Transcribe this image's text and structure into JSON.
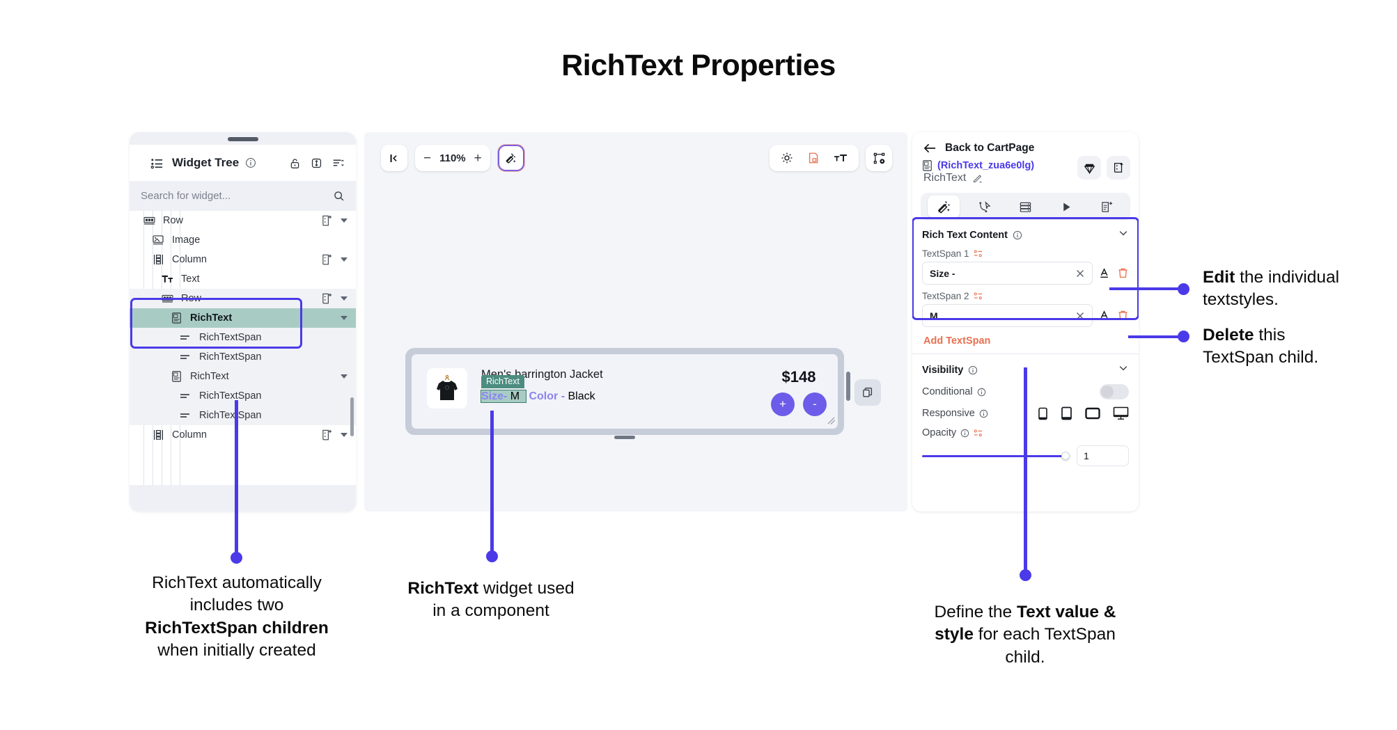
{
  "page": {
    "title": "RichText Properties"
  },
  "tree": {
    "panel_title": "Widget Tree",
    "search_placeholder": "Search for widget...",
    "icons": {
      "list": "widget-tree-icon",
      "info": "info-icon",
      "lock": "lock-icon",
      "expand": "expand-collapse-icon",
      "sort": "sort-icon",
      "search": "search-icon"
    },
    "items": [
      {
        "label": "Row",
        "type": "row",
        "depth": 1,
        "add": true,
        "caret": true,
        "alt": false,
        "selected": false
      },
      {
        "label": "Image",
        "type": "image",
        "depth": 2,
        "add": false,
        "caret": false,
        "alt": false,
        "selected": false
      },
      {
        "label": "Column",
        "type": "column",
        "depth": 2,
        "add": true,
        "caret": true,
        "alt": false,
        "selected": false
      },
      {
        "label": "Text",
        "type": "text",
        "depth": 3,
        "add": false,
        "caret": false,
        "alt": false,
        "selected": false
      },
      {
        "label": "Row",
        "type": "row",
        "depth": 3,
        "add": true,
        "caret": true,
        "alt": true,
        "selected": false
      },
      {
        "label": "RichText",
        "type": "richtext",
        "depth": 4,
        "add": false,
        "caret": true,
        "alt": false,
        "selected": true
      },
      {
        "label": "RichTextSpan",
        "type": "span",
        "depth": 5,
        "add": false,
        "caret": false,
        "alt": true,
        "selected": false
      },
      {
        "label": "RichTextSpan",
        "type": "span",
        "depth": 5,
        "add": false,
        "caret": false,
        "alt": true,
        "selected": false
      },
      {
        "label": "RichText",
        "type": "richtext",
        "depth": 4,
        "add": false,
        "caret": true,
        "alt": true,
        "selected": false
      },
      {
        "label": "RichTextSpan",
        "type": "span",
        "depth": 5,
        "add": false,
        "caret": false,
        "alt": true,
        "selected": false
      },
      {
        "label": "RichTextSpan",
        "type": "span",
        "depth": 5,
        "add": false,
        "caret": false,
        "alt": true,
        "selected": false
      },
      {
        "label": "Column",
        "type": "column",
        "depth": 2,
        "add": true,
        "caret": true,
        "alt": false,
        "selected": false
      }
    ]
  },
  "canvas": {
    "collapse_label": "collapse-left-panel-icon",
    "zoom_out": "−",
    "zoom_value": "110%",
    "zoom_in": "+",
    "magic_icon": "ai-gen-icon",
    "theme_icon": "theme-brightness-icon",
    "layout_icon": "page-layout-icon",
    "typography_icon": "typography-icon",
    "settings_icon": "canvas-settings-icon",
    "duplicate_icon": "duplicate-icon",
    "product": {
      "name": "Men's barrington Jacket",
      "size_key": "Size",
      "size_dash": "-",
      "size_value": "M",
      "color_key": "Color",
      "color_dash": "-",
      "color_value": "Black",
      "price": "$148",
      "plus": "+",
      "minus": "-",
      "badge": "RichText"
    }
  },
  "props": {
    "back_label": "Back to CartPage",
    "widget_id": "(RichText_zua6e0lg)",
    "widget_type": "RichText",
    "edit_icon": "pencil-icon",
    "action_icons": [
      "diamond-theme-icon",
      "add-component-icon"
    ],
    "tabs": [
      "properties-tab",
      "actions-tab",
      "backend-query-tab",
      "test-mode-tab",
      "add-element-tab"
    ],
    "rich_text": {
      "section_title": "Rich Text Content",
      "spans": [
        {
          "label": "TextSpan 1",
          "value": "Size -"
        },
        {
          "label": "TextSpan 2",
          "value": "M"
        }
      ],
      "clear_icon": "clear-icon",
      "style_icon": "text-style-icon",
      "delete_icon": "delete-icon",
      "add_label": "Add TextSpan"
    },
    "visibility": {
      "section_title": "Visibility",
      "conditional_label": "Conditional",
      "responsive_label": "Responsive",
      "opacity_label": "Opacity",
      "opacity_value": "1",
      "devices": [
        "phone-icon",
        "tablet-portrait-icon",
        "tablet-landscape-icon",
        "desktop-icon"
      ]
    }
  },
  "callouts": {
    "tree": {
      "line1": "RichText automatically",
      "line2": "includes two",
      "line3": "RichTextSpan children",
      "line4": "when initially created"
    },
    "canvas": {
      "bold": "RichText",
      "rest": " widget used",
      "line2": "in a component"
    },
    "edit": {
      "bold": "Edit",
      "rest": " the individual",
      "line2": "textstyles."
    },
    "delete": {
      "bold": "Delete",
      "rest": " this",
      "line2": "TextSpan child."
    },
    "define": {
      "pre": "Define the ",
      "bold1": "Text value &",
      "bold2": "style",
      "mid": " for each TextSpan",
      "line3": "child."
    }
  },
  "colors": {
    "accent": "#4b3ae8",
    "selection_green": "#a8ccc4",
    "orange": "#e8704f",
    "purple_btn": "#6c5ce9"
  }
}
